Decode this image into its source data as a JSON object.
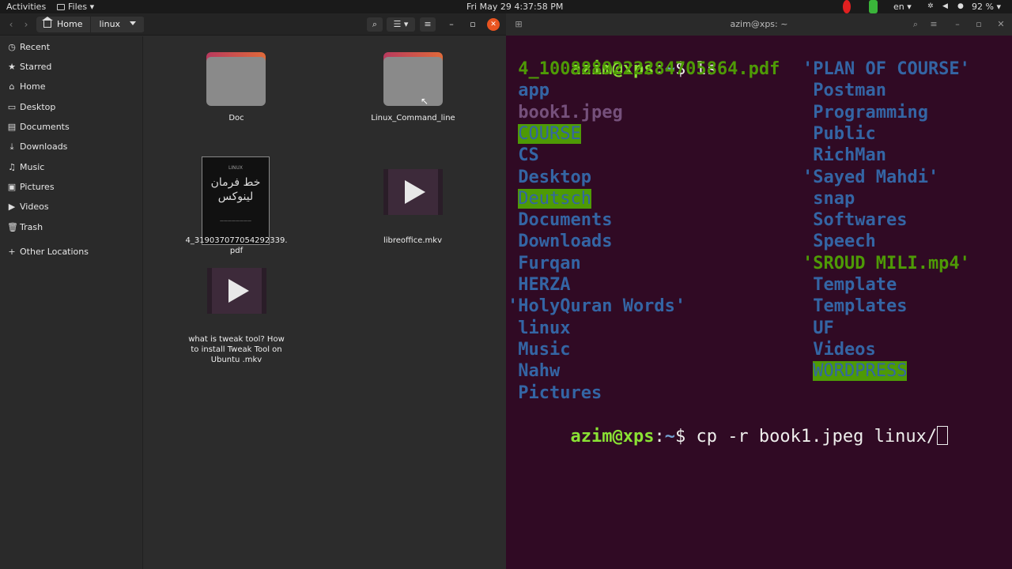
{
  "topbar": {
    "activities": "Activities",
    "app_menu": "Files",
    "clock": "Fri May 29  4:37:58 PM",
    "language": "en",
    "battery": "92 %"
  },
  "files": {
    "path": [
      "Home",
      "linux"
    ],
    "sidebar": [
      "Recent",
      "Starred",
      "Home",
      "Desktop",
      "Documents",
      "Downloads",
      "Music",
      "Pictures",
      "Videos",
      "Trash",
      "Other Locations"
    ],
    "items": {
      "doc": "Doc",
      "linux_cmd": "Linux_Command_line",
      "pdf_line1": "4_319037077054292339.",
      "pdf_line2": "pdf",
      "libre": "libreoffice.mkv",
      "tweak1": "what is tweak tool? How",
      "tweak2": "to install Tweak Tool on",
      "tweak3": "Ubuntu .mkv"
    }
  },
  "terminal": {
    "title": "azim@xps: ~",
    "prompt_user": "azim@xps",
    "prompt_sep": ":",
    "prompt_path": "~",
    "prompt_dollar": "$ ",
    "cmd1": "ls",
    "cmd2": "cp -r book1.jpeg linux/",
    "col1": [
      {
        "t": " 4_1008889222284705864.pdf",
        "c": "media"
      },
      {
        "t": " app",
        "c": "dir"
      },
      {
        "t": " book1.jpeg",
        "c": "img"
      },
      {
        "t": "COURSE",
        "c": "hl",
        "pad": " "
      },
      {
        "t": " CS",
        "c": "dir"
      },
      {
        "t": " Desktop",
        "c": "dir"
      },
      {
        "t": "Deutsch",
        "c": "hl",
        "pad": " "
      },
      {
        "t": " Documents",
        "c": "dir"
      },
      {
        "t": " Downloads",
        "c": "dir"
      },
      {
        "t": " Furqan",
        "c": "dir"
      },
      {
        "t": " HERZA",
        "c": "dir"
      },
      {
        "t": "'HolyQuran Words'",
        "c": "dir"
      },
      {
        "t": " linux",
        "c": "dir"
      },
      {
        "t": " Music",
        "c": "dir"
      },
      {
        "t": " Nahw",
        "c": "dir"
      },
      {
        "t": " Pictures",
        "c": "dir"
      }
    ],
    "col2": [
      {
        "t": "'PLAN OF COURSE'",
        "c": "dir"
      },
      {
        "t": " Postman",
        "c": "dir"
      },
      {
        "t": " Programming",
        "c": "dir"
      },
      {
        "t": " Public",
        "c": "dir"
      },
      {
        "t": " RichMan",
        "c": "dir"
      },
      {
        "t": "'Sayed Mahdi'",
        "c": "dir"
      },
      {
        "t": " snap",
        "c": "dir"
      },
      {
        "t": " Softwares",
        "c": "dir"
      },
      {
        "t": " Speech",
        "c": "dir"
      },
      {
        "t": "'SROUD MILI.mp4'",
        "c": "media"
      },
      {
        "t": " Template",
        "c": "dir"
      },
      {
        "t": " Templates",
        "c": "dir"
      },
      {
        "t": " UF",
        "c": "dir"
      },
      {
        "t": " Videos",
        "c": "dir"
      },
      {
        "t": "WORDPRESS",
        "c": "hl",
        "pad": " "
      }
    ]
  }
}
